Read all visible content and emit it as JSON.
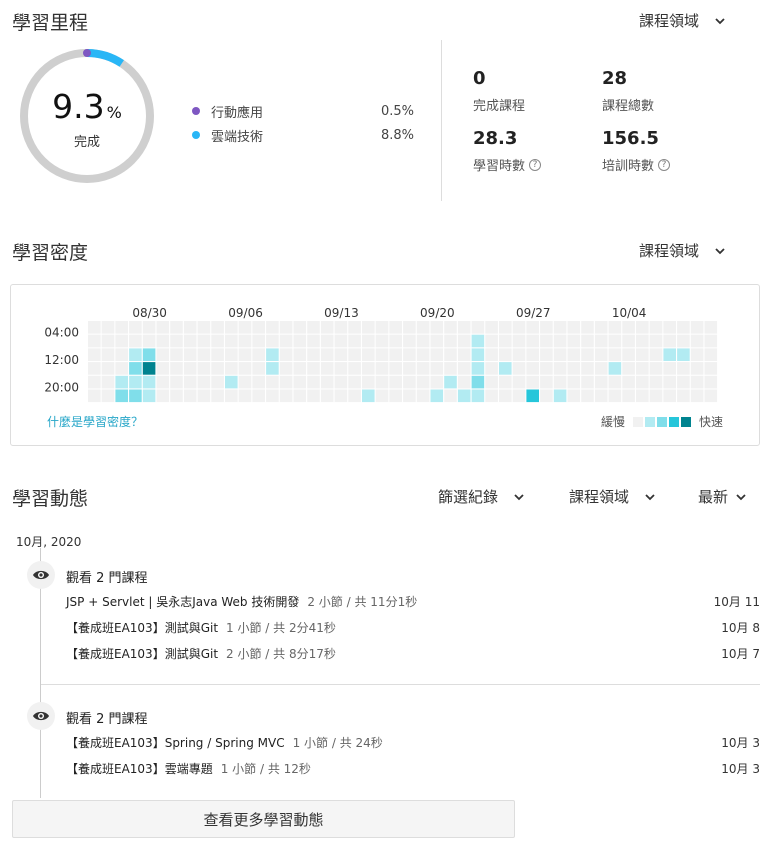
{
  "progress": {
    "title": "學習里程",
    "filter_label": "課程領域",
    "percent": "9.3",
    "percent_sign": "%",
    "complete_label": "完成",
    "legend": [
      {
        "name": "行動應用",
        "value": "0.5%",
        "color": "#7e57c2"
      },
      {
        "name": "雲端技術",
        "value": "8.8%",
        "color": "#29b6f6"
      }
    ],
    "stats": {
      "completed_courses": {
        "value": "0",
        "label": "完成課程"
      },
      "total_courses": {
        "value": "28",
        "label": "課程總數"
      },
      "study_hours": {
        "value": "28.3",
        "label": "學習時數"
      },
      "training_hours": {
        "value": "156.5",
        "label": "培訓時數"
      }
    },
    "help_glyph": "?"
  },
  "density": {
    "title": "學習密度",
    "filter_label": "課程領域",
    "date_labels": [
      "08/30",
      "09/06",
      "09/13",
      "09/20",
      "09/27",
      "10/04"
    ],
    "time_labels": [
      "04:00",
      "12:00",
      "20:00"
    ],
    "link_text": "什麼是學習密度？",
    "legend_slow": "緩慢",
    "legend_fast": "快速",
    "colors": {
      "empty": "#f1f1f1",
      "l1": "#b2ebf2",
      "l2": "#80deea",
      "l3": "#26c6da",
      "l4": "#00838f"
    },
    "cells": [
      [
        3,
        2,
        1
      ],
      [
        3,
        3,
        2
      ],
      [
        3,
        4,
        1
      ],
      [
        4,
        2,
        2
      ],
      [
        4,
        3,
        4
      ],
      [
        4,
        4,
        1
      ],
      [
        2,
        4,
        1
      ],
      [
        2,
        5,
        2
      ],
      [
        3,
        5,
        2
      ],
      [
        4,
        5,
        1
      ],
      [
        10,
        4,
        1
      ],
      [
        13,
        2,
        1
      ],
      [
        13,
        3,
        1
      ],
      [
        20,
        5,
        1
      ],
      [
        25,
        5,
        1
      ],
      [
        26,
        4,
        1
      ],
      [
        27,
        5,
        1
      ],
      [
        28,
        1,
        1
      ],
      [
        28,
        2,
        1
      ],
      [
        28,
        3,
        1
      ],
      [
        28,
        4,
        2
      ],
      [
        28,
        5,
        1
      ],
      [
        30,
        3,
        1
      ],
      [
        32,
        5,
        3
      ],
      [
        34,
        5,
        1
      ],
      [
        38,
        3,
        1
      ],
      [
        42,
        2,
        1
      ],
      [
        43,
        2,
        1
      ]
    ]
  },
  "activity": {
    "title": "學習動態",
    "filter_records": "篩選紀錄",
    "filter_domain": "課程領域",
    "sort_label": "最新",
    "month_header": "10月, 2020",
    "groups": [
      {
        "title": "觀看 2 門課程",
        "items": [
          {
            "course": "JSP + Servlet | 吳永志Java Web 技術開發",
            "meta": "2 小節 / 共 11分1秒",
            "date": "10月 11"
          },
          {
            "course": "【養成班EA103】測試與Git",
            "meta": "1 小節 / 共 2分41秒",
            "date": "10月 8"
          },
          {
            "course": "【養成班EA103】測試與Git",
            "meta": "2 小節 / 共 8分17秒",
            "date": "10月 7"
          }
        ]
      },
      {
        "title": "觀看 2 門課程",
        "items": [
          {
            "course": "【養成班EA103】Spring / Spring MVC",
            "meta": "1 小節 / 共 24秒",
            "date": "10月 3"
          },
          {
            "course": "【養成班EA103】雲端專題",
            "meta": "1 小節 / 共 12秒",
            "date": "10月 3"
          }
        ]
      }
    ],
    "more_button": "查看更多學習動態"
  }
}
